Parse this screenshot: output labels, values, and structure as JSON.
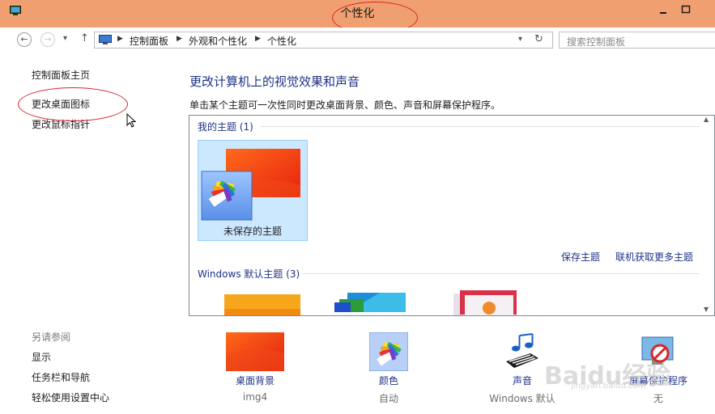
{
  "window": {
    "title": "个性化",
    "accent": "#f0a070"
  },
  "address_bar": {
    "back_icon": "arrow-left-icon",
    "forward_icon": "arrow-right-icon",
    "breadcrumbs": [
      "控制面板",
      "外观和个性化",
      "个性化"
    ],
    "search_placeholder": "搜索控制面板"
  },
  "sidebar": {
    "links": [
      "控制面板主页",
      "更改桌面图标",
      "更改鼠标指针"
    ],
    "see_also_heading": "另请参阅",
    "see_also": [
      "显示",
      "任务栏和导航",
      "轻松使用设置中心"
    ]
  },
  "main": {
    "title": "更改计算机上的视觉效果和声音",
    "description": "单击某个主题可一次性同时更改桌面背景、颜色、声音和屏幕保护程序。",
    "my_themes_label": "我的主题 (1)",
    "unsaved_theme_name": "未保存的主题",
    "save_theme_link": "保存主题",
    "get_more_link": "联机获取更多主题",
    "default_themes_label": "Windows 默认主题 (3)"
  },
  "bottom": [
    {
      "label": "桌面背景",
      "value": "img4",
      "icon": "wallpaper-icon"
    },
    {
      "label": "颜色",
      "value": "自动",
      "icon": "color-palette-icon"
    },
    {
      "label": "声音",
      "value": "Windows 默认",
      "icon": "music-notes-icon"
    },
    {
      "label": "屏幕保护程序",
      "value": "无",
      "icon": "screensaver-icon"
    }
  ],
  "watermark": {
    "text": "Baidu经验",
    "url": "jingyan.baidu.com"
  }
}
